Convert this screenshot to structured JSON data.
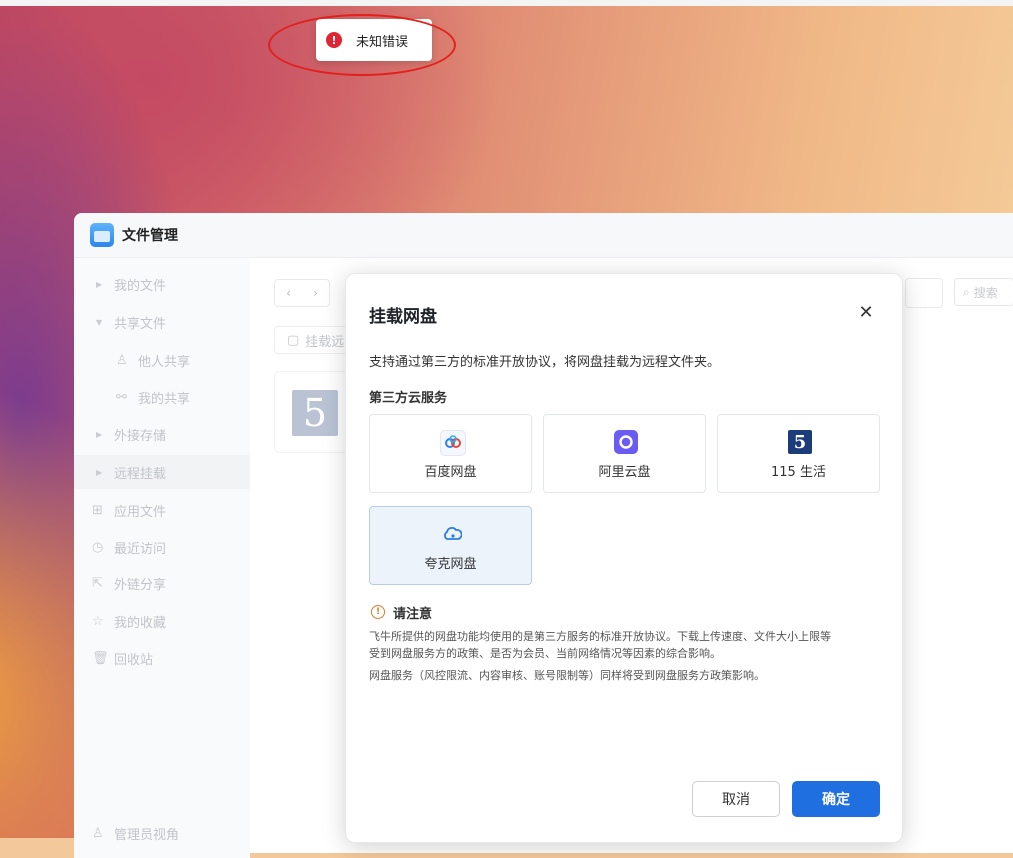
{
  "toast": {
    "icon": "error-circle-icon",
    "text": "未知错误"
  },
  "window": {
    "title": "文件管理",
    "sidebar": {
      "items": [
        {
          "label": "我的文件",
          "icon": "caret-right-icon"
        },
        {
          "label": "共享文件",
          "icon": "caret-down-icon"
        },
        {
          "label": "他人共享",
          "icon": "user-icon"
        },
        {
          "label": "我的共享",
          "icon": "share-icon"
        },
        {
          "label": "外接存储",
          "icon": "caret-right-icon"
        },
        {
          "label": "远程挂载",
          "icon": "caret-right-icon"
        },
        {
          "label": "应用文件",
          "icon": "apps-grid-icon"
        },
        {
          "label": "最近访问",
          "icon": "clock-icon"
        },
        {
          "label": "外链分享",
          "icon": "external-link-icon"
        },
        {
          "label": "我的收藏",
          "icon": "star-icon"
        },
        {
          "label": "回收站",
          "icon": "trash-icon"
        }
      ],
      "footer": "管理员视角"
    },
    "path_chip": "挂载远",
    "search_placeholder": "搜索"
  },
  "modal": {
    "title": "挂载网盘",
    "description": "支持通过第三方的标准开放协议，将网盘挂载为远程文件夹。",
    "section_label": "第三方云服务",
    "services": [
      {
        "label": "百度网盘",
        "icon": "baidu-netdisk-icon",
        "color": "#2f7ff0"
      },
      {
        "label": "阿里云盘",
        "icon": "aliyun-drive-icon",
        "color": "#6a5cf2"
      },
      {
        "label": "115 生活",
        "icon": "115-logo-icon",
        "color": "#1c3d7a"
      },
      {
        "label": "夸克网盘",
        "icon": "quark-cloud-icon",
        "color": "#2a7de1"
      }
    ],
    "notice": {
      "title": "请注意",
      "line1": "飞牛所提供的网盘功能均使用的是第三方服务的标准开放协议。下载上传速度、文件大小上限等",
      "line2": "受到网盘服务方的政策、是否为会员、当前网络情况等因素的综合影响。",
      "line3": "网盘服务（风控限流、内容审核、账号限制等）同样将受到网盘服务方政策影响。"
    },
    "cancel_label": "取消",
    "ok_label": "确定"
  }
}
